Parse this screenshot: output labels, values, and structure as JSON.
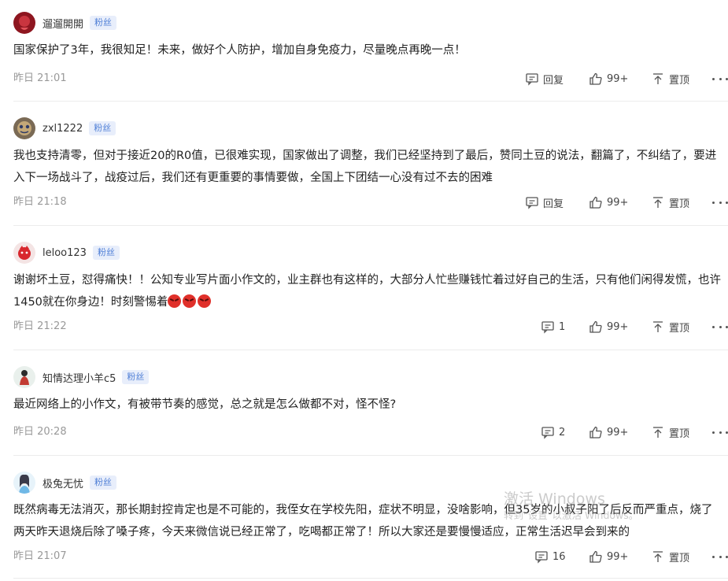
{
  "actions": {
    "reply_label": "回复",
    "like_count": "99+",
    "pin_label": "置顶"
  },
  "comments": [
    {
      "username": "遛遛開開",
      "badge": "粉丝",
      "text": "国家保护了3年，我很知足！未来，做好个人防护，增加自身免疫力，尽量晚点再晚一点！",
      "time": "昨日 21:01"
    },
    {
      "username": "zxl1222",
      "badge": "粉丝",
      "text": "我也支持清零，但对于接近20的R0值，已很难实现，国家做出了调整，我们已经坚持到了最后，赞同土豆的说法，翻篇了，不纠结了，要进入下一场战斗了，战疫过后，我们还有更重要的事情要做，全国上下团结一心没有过不去的困难",
      "time": "昨日 21:18"
    },
    {
      "username": "leloo123",
      "badge": "粉丝",
      "text": "谢谢坏土豆，怼得痛快！！公知专业写片面小作文的，业主群也有这样的，大部分人忙些赚钱忙着过好自己的生活，只有他们闲得发慌，也许1450就在你身边！时刻警惕着",
      "time": "昨日 21:22",
      "reply_count": "1",
      "emoji_icons": [
        "angry-emoji",
        "angry-emoji",
        "angry-emoji"
      ]
    },
    {
      "username": "知情达理小羊c5",
      "badge": "粉丝",
      "text": "最近网络上的小作文，有被带节奏的感觉，总之就是怎么做都不对，怪不怪?",
      "time": "昨日 20:28",
      "reply_count": "2"
    },
    {
      "username": "极兔无忧",
      "badge": "粉丝",
      "text": "既然病毒无法消灭，那长期封控肯定也是不可能的，我侄女在学校先阳，症状不明显，没啥影响，但35岁的小叔子阳了后反而严重点，烧了两天昨天退烧后除了嗓子疼，今天来微信说已经正常了，吃喝都正常了！所以大家还是要慢慢适应，正常生活迟早会到来的",
      "time": "昨日 21:07",
      "reply_count": "16"
    }
  ],
  "watermark": {
    "title": "激活 Windows",
    "subtitle": "转到\"设置\"以激活 Windows。"
  },
  "colors": {
    "badge_text": "#4f7fd6",
    "badge_bg": "#e8eefb",
    "time_text": "#999999"
  }
}
